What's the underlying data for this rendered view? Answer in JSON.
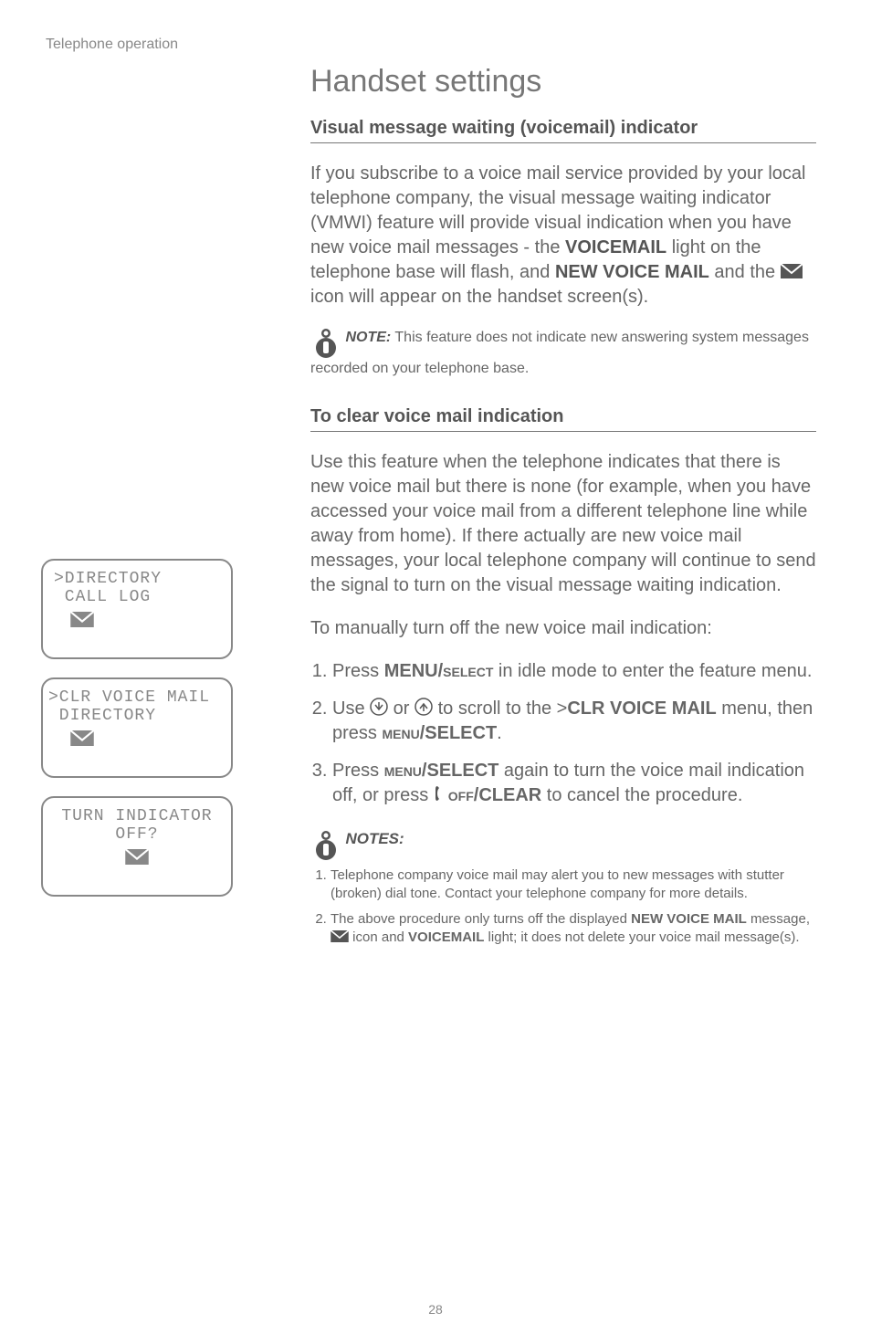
{
  "header": "Telephone operation",
  "title": "Handset settings",
  "section1": {
    "heading": "Visual message waiting (voicemail) indicator",
    "para_a": "If you subscribe to a voice mail service provided by your local telephone company, the visual message waiting indicator (VMWI) feature will provide visual indication when you have new voice mail messages - the ",
    "bold_a": "VOICEMAIL",
    "para_b": " light on the telephone base will flash, and ",
    "bold_b": "NEW VOICE MAIL",
    "para_c": " and the ",
    "para_d": " icon will appear on the handset screen(s).",
    "note_label": "NOTE:",
    "note_text": " This feature does not indicate new answering system messages recorded on your telephone base."
  },
  "section2": {
    "heading": "To clear voice mail indication",
    "para1": "Use this feature when the telephone indicates that there is new voice mail but there is none (for example, when you have accessed your voice mail from a different telephone line while away from home). If there actually are new voice mail messages, your local telephone company will continue to send the signal to turn on the visual message waiting indication.",
    "para2": "To manually turn off the new voice mail indication:",
    "step1_a": "Press ",
    "step1_menu": "MENU/",
    "step1_select": "select",
    "step1_b": " in idle mode to enter the feature menu.",
    "step2_a": "Use ",
    "step2_b": " or ",
    "step2_c": " to scroll to the >",
    "step2_bold": "CLR VOICE MAIL",
    "step2_d": " menu, then press ",
    "step2_menu": "menu",
    "step2_select": "/SELECT",
    "step2_e": ".",
    "step3_a": "Press ",
    "step3_menu": "menu",
    "step3_select": "/SELECT",
    "step3_b": " again to turn the voice mail indication off, or press ",
    "step3_off": "off",
    "step3_clear": "/CLEAR",
    "step3_c": " to cancel the procedure."
  },
  "notes": {
    "label": "NOTES:",
    "n1": "Telephone company voice mail may alert you to new messages with stutter (broken) dial tone. Contact your telephone company for more details.",
    "n2_a": "The above procedure only turns off the displayed ",
    "n2_bold1": "NEW VOICE MAIL",
    "n2_b": " message, ",
    "n2_c": " icon and ",
    "n2_bold2": "VOICEMAIL",
    "n2_d": " light; it does not delete your voice mail message(s)."
  },
  "sidebar": {
    "lcd1_l1": ">DIRECTORY",
    "lcd1_l2": " CALL LOG",
    "lcd2_l1": ">CLR VOICE MAIL",
    "lcd2_l2": " DIRECTORY",
    "lcd3_l1": "TURN INDICATOR",
    "lcd3_l2": "OFF?"
  },
  "page_number": "28"
}
